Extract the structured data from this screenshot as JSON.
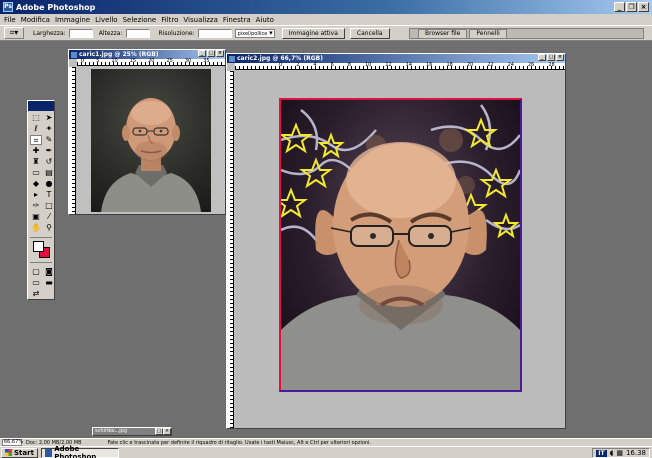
{
  "window": {
    "title": "Adobe Photoshop"
  },
  "menubar": [
    "File",
    "Modifica",
    "Immagine",
    "Livello",
    "Selezione",
    "Filtro",
    "Visualizza",
    "Finestra",
    "Aiuto"
  ],
  "options": {
    "width_label": "Larghezza:",
    "height_label": "Altezza:",
    "resolution_label": "Risoluzione:",
    "units_select": "pixel/pollice",
    "front_image_button": "Immagine attiva",
    "clear_button": "Cancella"
  },
  "palette_well": {
    "tabs": [
      "Browser file",
      "Pennelli"
    ]
  },
  "doc1": {
    "title": "caric1.jpg @ 25% (RGB)",
    "ruler_labels": [
      "0",
      "5",
      "10",
      "15",
      "20",
      "25",
      "30",
      "35"
    ]
  },
  "doc2": {
    "title": "caric2.jpg @ 66,7% (RGB)",
    "ruler_labels": [
      "0",
      "2",
      "4",
      "6",
      "8",
      "10",
      "12",
      "14",
      "16",
      "18",
      "20",
      "22",
      "24",
      "26",
      "28"
    ]
  },
  "minimized_doc": {
    "title": "schiribo...jpg"
  },
  "statusbar": {
    "zoom": "66,67%",
    "doc_size": "Doc: 2,00 MB/2,00 MB",
    "hint": "Fate clic e trascinate per definire il riquadro di ritaglio. Usate i tasti Maiusc, Alt e Ctrl per ulteriori opzioni."
  },
  "taskbar": {
    "start_label": "Start",
    "task_label": "Adobe Photoshop",
    "tray_lang": "IT",
    "clock": "16.38"
  },
  "colors": {
    "foreground": "#ffffff",
    "background": "#e0103c",
    "frame_outer_red": "#e01040",
    "frame_outer_purple": "#4a1a9a"
  }
}
